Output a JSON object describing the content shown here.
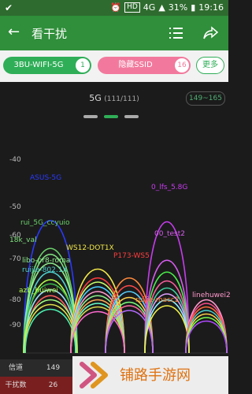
{
  "status": {
    "carrier_icon": "check-icon",
    "hd": "HD",
    "net": "4G",
    "battery": "31%",
    "time": "19:16"
  },
  "appbar": {
    "title": "看干扰"
  },
  "filters": {
    "ssid": {
      "label": "3BU-WIFI-5G",
      "count": "1"
    },
    "hidden": {
      "label": "隐藏SSID",
      "count": "16"
    },
    "more": "更多"
  },
  "chart": {
    "band": "5G",
    "band_count": "(111/111)",
    "range_btn": "149~165",
    "yticks": [
      "-40",
      "-50",
      "-60",
      "-70",
      "-80",
      "-90"
    ],
    "ssids": [
      {
        "name": "ASUS-5G",
        "color": "#2a39ff"
      },
      {
        "name": "0_lfs_5.8G",
        "color": "#c83cf0"
      },
      {
        "name": "rui_5G_ccyuio",
        "color": "#6ad06a"
      },
      {
        "name": "18k_val",
        "color": "#7fe07f"
      },
      {
        "name": "WS12-DOT1X",
        "color": "#f2e84a"
      },
      {
        "name": "libo-pr8-roma",
        "color": "#8ff08f"
      },
      {
        "name": "ruijie-802.1X",
        "color": "#4fd0d0"
      },
      {
        "name": "P173-WS5",
        "color": "#ff3d3d"
      },
      {
        "name": "00_test2",
        "color": "#d85cf0"
      },
      {
        "name": "linehuwei2",
        "color": "#ff9acd"
      },
      {
        "name": "ruijie-macc2",
        "color": "#ff8a3d"
      },
      {
        "name": "azb_huiwei",
        "color": "#b4ff4a"
      }
    ]
  },
  "bottom": {
    "channel_label": "信道",
    "channel_value": "149",
    "interf_label": "干扰数",
    "interf_value": "26"
  },
  "watermark": {
    "text": "铺路手游网"
  }
}
